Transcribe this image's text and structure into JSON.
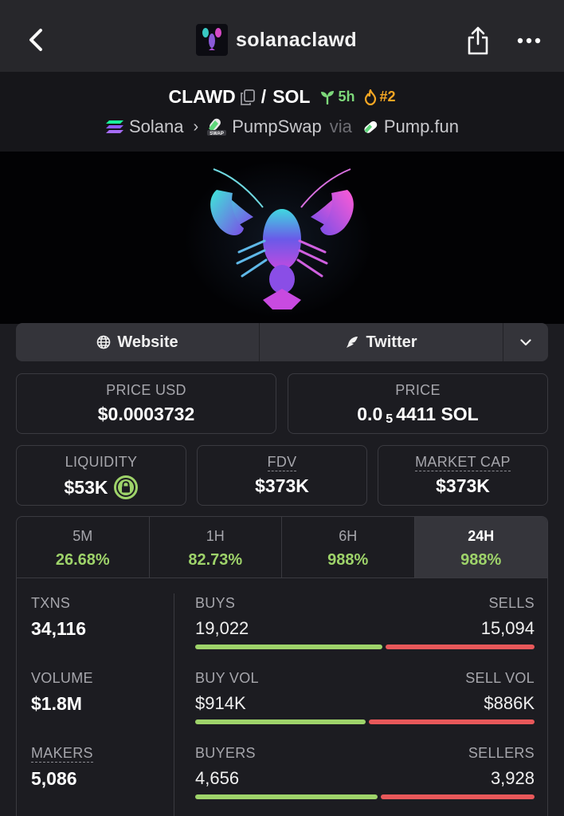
{
  "header": {
    "title": "solanaclawd"
  },
  "pair": {
    "base": "CLAWD",
    "separator": "/",
    "quote": "SOL",
    "age": "5h",
    "rank": "#2",
    "chain": "Solana",
    "dex": "PumpSwap",
    "via": "via",
    "launchpad": "Pump.fun",
    "dex_badge": "SWAP"
  },
  "links": {
    "website": "Website",
    "twitter": "Twitter"
  },
  "prices": {
    "usd_label": "PRICE USD",
    "usd_value": "$0.0003732",
    "native_label": "PRICE",
    "native_prefix": "0.0",
    "native_zeros": "5",
    "native_rest": "4411 SOL"
  },
  "metrics": {
    "liquidity_label": "LIQUIDITY",
    "liquidity_value": "$53K",
    "fdv_label": "FDV",
    "fdv_value": "$373K",
    "mcap_label": "MARKET CAP",
    "mcap_value": "$373K"
  },
  "timeframes": [
    {
      "label": "5M",
      "change": "26.68%"
    },
    {
      "label": "1H",
      "change": "82.73%"
    },
    {
      "label": "6H",
      "change": "988%"
    },
    {
      "label": "24H",
      "change": "988%"
    }
  ],
  "active_timeframe": "24H",
  "stats": {
    "txns_label": "TXNS",
    "txns_value": "34,116",
    "volume_label": "VOLUME",
    "volume_value": "$1.8M",
    "makers_label": "MAKERS",
    "makers_value": "5,086",
    "buys_label": "BUYS",
    "buys_value": "19,022",
    "sells_label": "SELLS",
    "sells_value": "15,094",
    "buy_vol_label": "BUY VOL",
    "buy_vol_value": "$914K",
    "sell_vol_label": "SELL VOL",
    "sell_vol_value": "$886K",
    "buyers_label": "BUYERS",
    "buyers_value": "4,656",
    "sellers_label": "SELLERS",
    "sellers_value": "3,928",
    "buy_ratio_txns": 0.557,
    "buy_ratio_vol": 0.508,
    "buy_ratio_makers": 0.542
  },
  "colors": {
    "positive": "#9ed36a",
    "negative": "#e8585a",
    "age": "#7dd87a",
    "rank": "#f5a623"
  }
}
